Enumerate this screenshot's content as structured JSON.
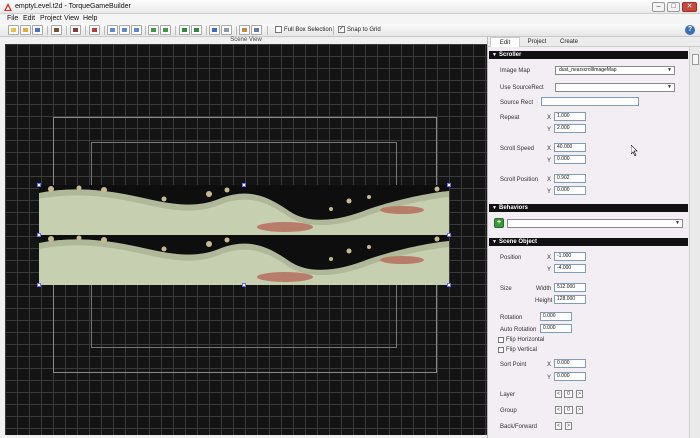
{
  "window": {
    "title": "emptyLevel.t2d - TorqueGameBuilder",
    "minimize": "–",
    "maximize": "□",
    "close": "✕"
  },
  "menu": {
    "items": [
      "File",
      "Edit",
      "Project",
      "View",
      "Help"
    ]
  },
  "toolbar": {
    "full_box_selection_label": "Full Box Selection",
    "full_box_selection_checked": false,
    "snap_to_grid_label": "Snap to Grid",
    "snap_to_grid_checked": true,
    "help_label": "?"
  },
  "scene": {
    "header": "Scene View"
  },
  "panel": {
    "tabs": [
      "Edit",
      "Project",
      "Create"
    ],
    "active_tab": "Edit",
    "scroller": {
      "title": "Scroller",
      "image_map_label": "Image Map",
      "image_map_value": "dust_nearscrollImageMap",
      "use_source_rect_label": "Use SourceRect",
      "use_source_rect_value": "",
      "source_rect_label": "Source Rect",
      "source_rect_value": "",
      "repeat_label": "Repeat",
      "repeat_x": "1.000",
      "repeat_y": "2.000",
      "scroll_speed_label": "Scroll Speed",
      "scroll_speed_x": "40.000",
      "scroll_speed_y": "0.000",
      "scroll_position_label": "Scroll Position",
      "scroll_position_x": "0.902",
      "scroll_position_y": "0.000",
      "x_label": "X",
      "y_label": "Y"
    },
    "behaviors": {
      "title": "Behaviors",
      "add_label": "+",
      "dropdown_value": ""
    },
    "scene_object": {
      "title": "Scene Object",
      "position_label": "Position",
      "position_x": "-1.000",
      "position_y": "-4.000",
      "size_label": "Size",
      "width_label": "Width",
      "width_value": "512.000",
      "height_label": "Height",
      "height_value": "128.000",
      "rotation_label": "Rotation",
      "rotation_value": "0.000",
      "auto_rotation_label": "Auto Rotation",
      "auto_rotation_value": "0.000",
      "flip_horizontal_label": "Flip Horizontal",
      "flip_vertical_label": "Flip Vertical",
      "sort_point_label": "Sort Point",
      "sort_point_x": "0.000",
      "sort_point_y": "0.000",
      "layer_label": "Layer",
      "layer_value": "0",
      "group_label": "Group",
      "group_value": "0",
      "back_forward_label": "Back/Forward",
      "stepper_left": "<",
      "stepper_right": ">",
      "x_label": "X",
      "y_label": "Y"
    }
  },
  "colors": {
    "terrain_fill": "#c6cfb0",
    "terrain_shadow": "#a0a98a",
    "rock": "#c9b98e",
    "oval": "#b87c6a",
    "section_bar": "#111111",
    "panel_bg": "#f3eef3"
  }
}
